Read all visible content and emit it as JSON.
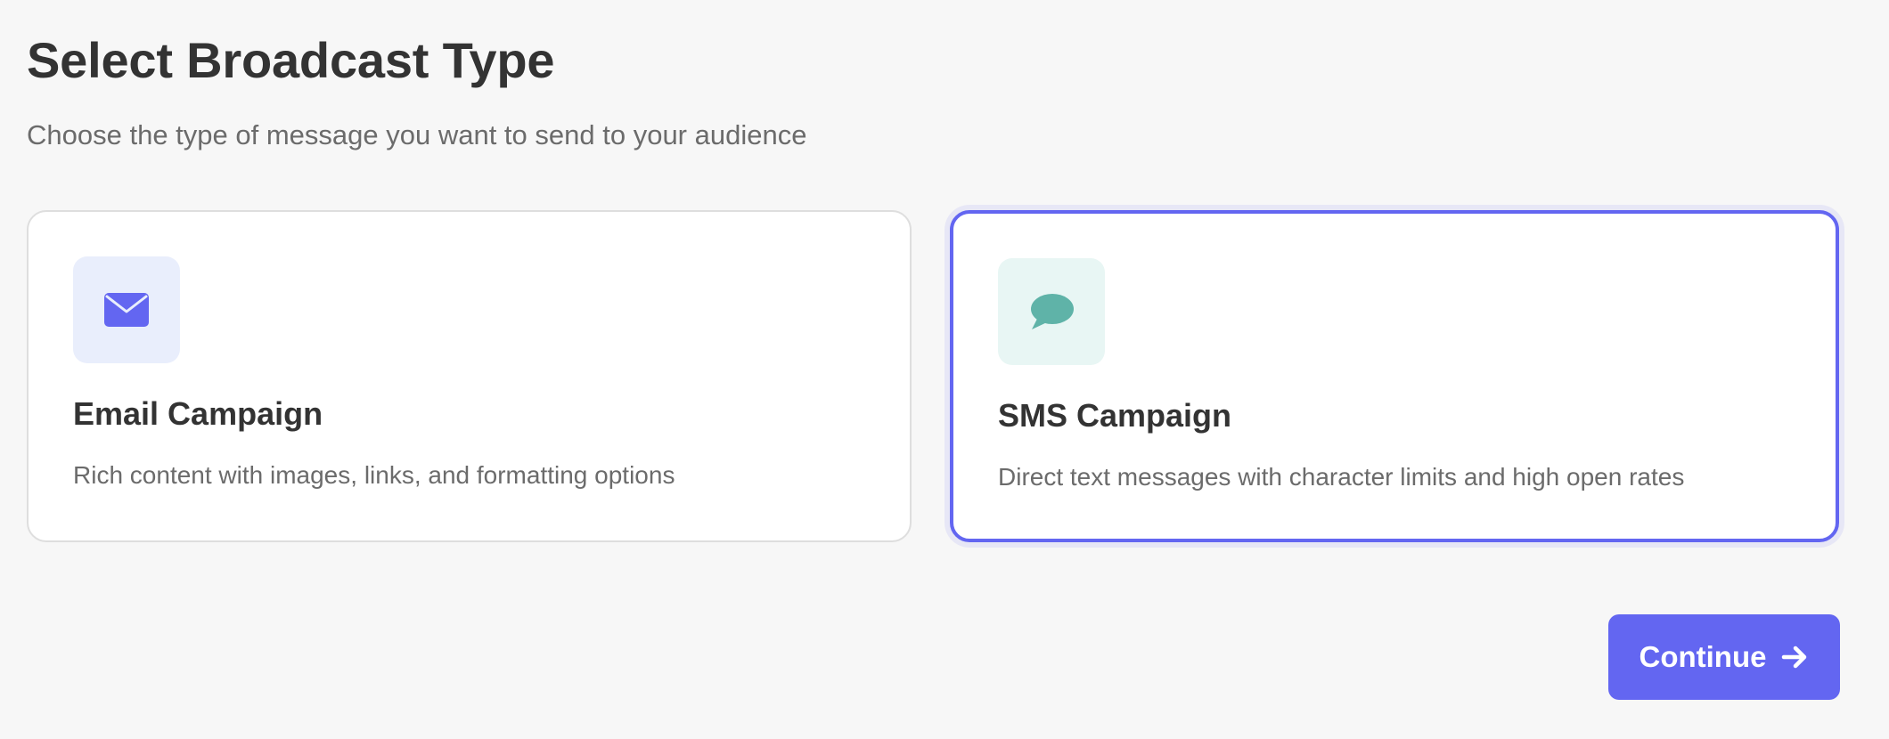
{
  "header": {
    "title": "Select Broadcast Type",
    "subtitle": "Choose the type of message you want to send to your audience"
  },
  "options": [
    {
      "id": "email",
      "title": "Email Campaign",
      "description": "Rich content with images, links, and formatting options",
      "icon": "envelope-icon",
      "icon_color": "#6366f1",
      "icon_bg": "#e9eefc",
      "selected": false
    },
    {
      "id": "sms",
      "title": "SMS Campaign",
      "description": "Direct text messages with character limits and high open rates",
      "icon": "chat-bubble-icon",
      "icon_color": "#5fb3a8",
      "icon_bg": "#e8f6f4",
      "selected": true
    }
  ],
  "actions": {
    "continue_label": "Continue",
    "continue_icon": "arrow-right-icon"
  },
  "colors": {
    "accent": "#6366f1",
    "background": "#f7f7f7",
    "card_background": "#ffffff",
    "text_primary": "#333333",
    "text_secondary": "#6b6b6b"
  }
}
